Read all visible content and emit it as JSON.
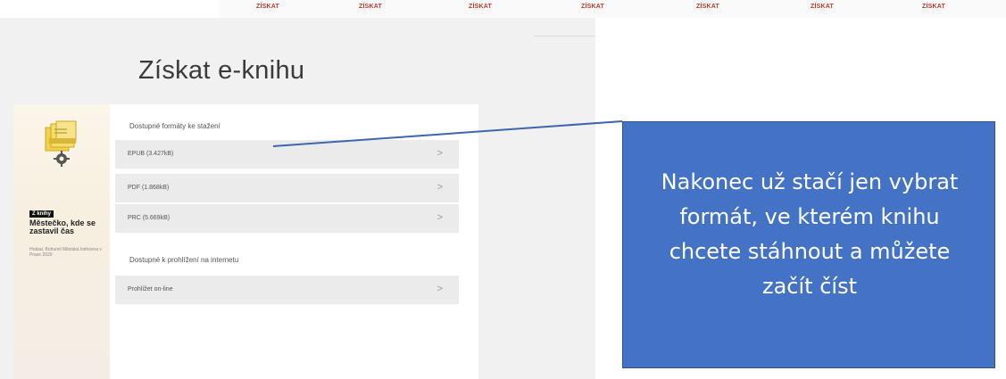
{
  "top_buttons": [
    "ZÍSKAT",
    "ZÍSKAT",
    "ZÍSKAT",
    "ZÍSKAT",
    "ZÍSKAT",
    "ZÍSKAT",
    "ZÍSKAT"
  ],
  "page": {
    "title": "Získat e-knihu"
  },
  "book": {
    "tag": "Z knihy",
    "title": "Městečko, kde se zastavil čas",
    "subtitle": "Hrabal, Bohumil Městská knihovna v Praze 2020"
  },
  "download": {
    "label": "Dostupné formáty ke stažení",
    "formats": [
      {
        "label": "EPUB (3.427kB)",
        "chevron": ">"
      },
      {
        "label": "PDF (1.868kB)",
        "chevron": ">"
      },
      {
        "label": "PRC (5.669kB)",
        "chevron": ">"
      }
    ]
  },
  "online": {
    "label": "Dostupné k prohlížení na internetu",
    "items": [
      {
        "label": "Prohlížet on-line",
        "chevron": ">"
      }
    ]
  },
  "callout": {
    "text": "Nakonec už stačí jen vybrat formát, ve kterém knihu chcete stáhnout a můžete začít číst"
  },
  "colors": {
    "callout_bg": "#4472c4",
    "callout_border": "#2f528f",
    "accent_red": "#c0392b"
  },
  "icons": [
    "book-stack-icon",
    "gear-icon",
    "chevron-right-icon"
  ]
}
